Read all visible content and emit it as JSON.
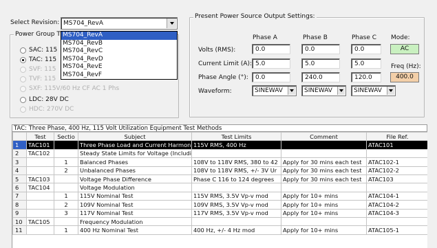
{
  "revision": {
    "label": "Select Revision:",
    "value": "MS704_RevA",
    "options": [
      "MS704_RevA",
      "MS704_RevB",
      "MS704_RevC",
      "MS704_RevD",
      "MS704_RevE",
      "MS704_RevF"
    ]
  },
  "power_group": {
    "title": "Power Group T",
    "options": [
      {
        "label": "SAC: 115",
        "selected": false,
        "disabled": false
      },
      {
        "label": "TAC: 115",
        "selected": true,
        "disabled": false
      },
      {
        "label": "SVF: 115",
        "selected": false,
        "disabled": true
      },
      {
        "label": "TVF: 115",
        "selected": false,
        "disabled": true
      },
      {
        "label": "SXF: 115V/60 Hz CF AC 1 Phs",
        "selected": false,
        "disabled": true
      },
      {
        "label": "LDC: 28V DC",
        "selected": false,
        "disabled": false
      },
      {
        "label": "HDC: 270V DC",
        "selected": false,
        "disabled": true
      }
    ]
  },
  "output_settings": {
    "title": "Present Power Source Output Settings:",
    "phase_headers": [
      "Phase A",
      "Phase B",
      "Phase C"
    ],
    "mode_label": "Mode:",
    "mode_value": "AC",
    "freq_label": "Freq (Hz):",
    "freq_value": "400.0",
    "rows": [
      {
        "label": "Volts (RMS):",
        "values": [
          "0.0",
          "0.0",
          "0.0"
        ]
      },
      {
        "label": "Current Limit (A):",
        "values": [
          "5.0",
          "5.0",
          "5.0"
        ]
      },
      {
        "label": "Phase Angle (°):",
        "values": [
          "0.0",
          "240.0",
          "120.0"
        ]
      }
    ],
    "waveform_label": "Waveform:",
    "waveforms": [
      "SINEWAV",
      "SINEWAV",
      "SINEWAV"
    ]
  },
  "table": {
    "title": "TAC:  Three Phase, 400 Hz, 115 Volt Utilization Equipment Test Methods",
    "columns": [
      "Test",
      "Sectio",
      "Subject",
      "Test Limits",
      "Comment",
      "File Ref."
    ],
    "rows": [
      {
        "n": "1",
        "test": "TAC101",
        "section": "",
        "subject": "Three Phase Load and Current Harmoni",
        "limits": "115V RMS, 400 Hz",
        "comment": "",
        "file": "ATAC101"
      },
      {
        "n": "2",
        "test": "TAC102",
        "section": "",
        "subject": "Steady State Limits for Voltage (Includin",
        "limits": "",
        "comment": "",
        "file": ""
      },
      {
        "n": "3",
        "test": "",
        "section": "1",
        "subject": "Balanced Phases",
        "limits": "108V to 118V RMS, 380 to 42",
        "comment": "Apply for 30 mins each test",
        "file": "ATAC102-1"
      },
      {
        "n": "4",
        "test": "",
        "section": "2",
        "subject": "Unbalanced Phases",
        "limits": "108V to 118V RMS, +/- 3V Ur",
        "comment": "Apply for 30 mins each test",
        "file": "ATAC102-2"
      },
      {
        "n": "5",
        "test": "TAC103",
        "section": "",
        "subject": "Voltage Phase Difference",
        "limits": "Phase C 116 to 124 degrees",
        "comment": "Apply for 30 mins each test",
        "file": "ATAC103"
      },
      {
        "n": "6",
        "test": "TAC104",
        "section": "",
        "subject": "Voltage Modulation",
        "limits": "",
        "comment": "",
        "file": ""
      },
      {
        "n": "7",
        "test": "",
        "section": "1",
        "subject": "115V Nominal Test",
        "limits": "115V RMS, 3.5V Vp-v mod",
        "comment": "Apply for 10+ mins",
        "file": "ATAC104-1"
      },
      {
        "n": "8",
        "test": "",
        "section": "2",
        "subject": "109V Nominal Test",
        "limits": "109V RMS, 3.5V Vp-v mod",
        "comment": "Apply for 10+ mins",
        "file": "ATAC104-2"
      },
      {
        "n": "9",
        "test": "",
        "section": "3",
        "subject": "117V Nominal Test",
        "limits": "117V RMS, 3.5V Vp-v mod",
        "comment": "Apply for 10+ mins",
        "file": "ATAC104-3"
      },
      {
        "n": "10",
        "test": "TAC105",
        "section": "",
        "subject": "Frequency Modulation",
        "limits": "",
        "comment": "",
        "file": ""
      },
      {
        "n": "11",
        "test": "",
        "section": "1",
        "subject": "400 Hz Nominal Test",
        "limits": "400 Hz, +/- 4 Hz mod",
        "comment": "Apply for 10+ mins",
        "file": "ATAC105-1"
      }
    ]
  },
  "colors": {
    "mode_bg": "#c9f0c0",
    "freq_bg": "#f3cfa8",
    "selection": "#2f5fc4"
  }
}
